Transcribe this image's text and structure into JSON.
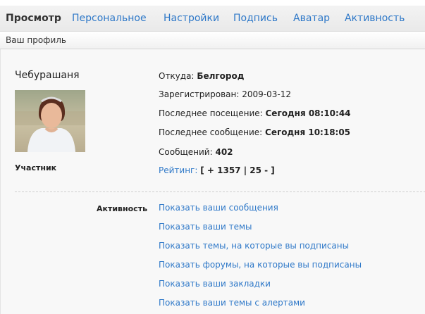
{
  "tabs": [
    {
      "label": "Просмотр",
      "active": true
    },
    {
      "label": "Персональное",
      "active": false
    },
    {
      "label": "Настройки",
      "active": false
    },
    {
      "label": "Подпись",
      "active": false
    },
    {
      "label": "Аватар",
      "active": false
    },
    {
      "label": "Активность",
      "active": false
    }
  ],
  "breadcrumb": "Ваш профиль",
  "profile": {
    "username": "Чебурашаня",
    "role": "Участник",
    "from_label": "Откуда:",
    "from_value": "Белгород",
    "registered_label": "Зарегистрирован:",
    "registered_value": "2009-03-12",
    "last_visit_label": "Последнее посещение:",
    "last_visit_value": "Сегодня 08:10:44",
    "last_post_label": "Последнее сообщение:",
    "last_post_value": "Сегодня 10:18:05",
    "posts_label": "Сообщений:",
    "posts_value": "402",
    "rating_label": "Рейтинг:",
    "rating_value": "[ + 1357 | 25 - ]"
  },
  "activity": {
    "label": "Активность",
    "links": [
      "Показать ваши сообщения",
      "Показать ваши темы",
      "Показать темы, на которые вы подписаны",
      "Показать форумы, на которые вы подписаны",
      "Показать ваши закладки",
      "Показать ваши темы с алертами"
    ]
  },
  "colors": {
    "link": "#2e78c8",
    "text": "#222222",
    "panel": "#f8f8f8"
  }
}
